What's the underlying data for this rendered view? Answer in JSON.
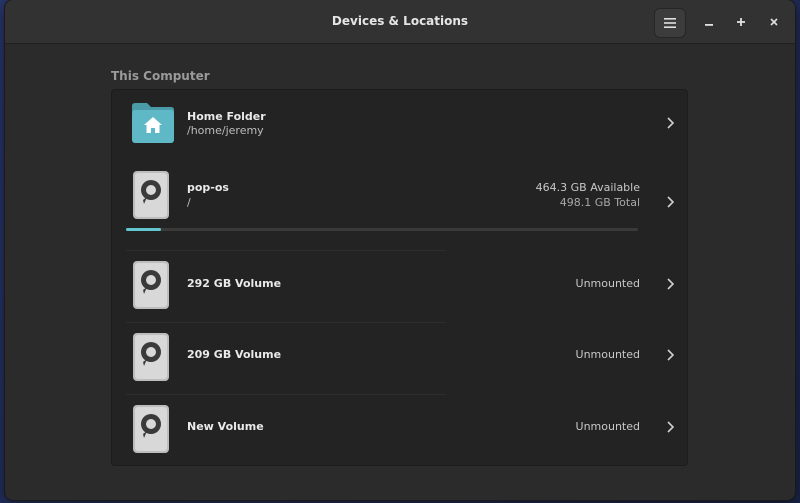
{
  "window": {
    "title": "Devices & Locations"
  },
  "section": {
    "label": "This Computer"
  },
  "home": {
    "name": "Home Folder",
    "path": "/home/jeremy"
  },
  "popos": {
    "name": "pop-os",
    "path": "/",
    "available": "464.3 GB Available",
    "total": "498.1 GB Total",
    "used_fraction": 0.068
  },
  "volumes": [
    {
      "name": "292 GB Volume",
      "status": "Unmounted"
    },
    {
      "name": "209 GB Volume",
      "status": "Unmounted"
    },
    {
      "name": "New Volume",
      "status": "Unmounted"
    }
  ],
  "colors": {
    "accent": "#63c7d2",
    "folder": "#5fb8c6"
  }
}
